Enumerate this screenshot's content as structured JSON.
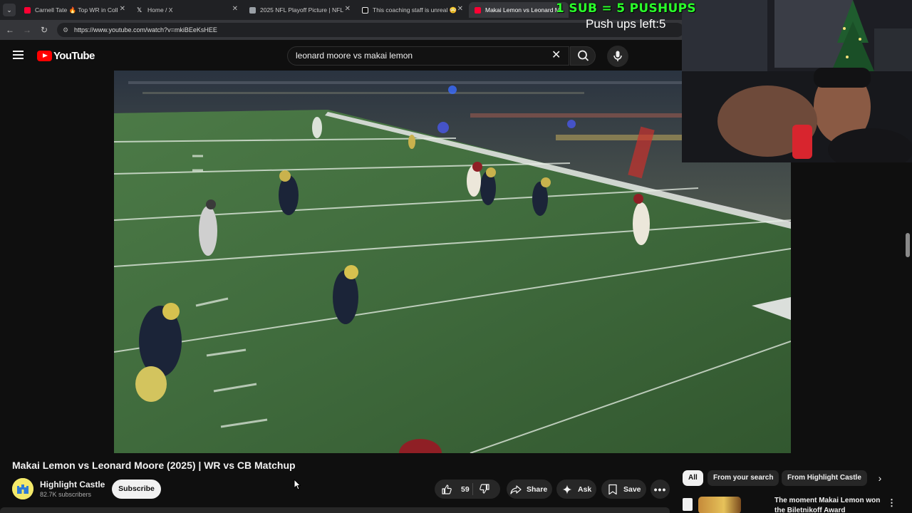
{
  "browser": {
    "tabs": [
      {
        "title": "Carnell Tate 🔥 Top WR in Coll",
        "fav_color": "#ff0033"
      },
      {
        "title": "Home / X",
        "fav_color": "#ffffff"
      },
      {
        "title": "2025 NFL Playoff Picture | NFL",
        "fav_color": "#9aa0a6"
      },
      {
        "title": "This coaching staff is unreal 😳",
        "fav_color": "#ffffff"
      },
      {
        "title": "Makai Lemon vs Leonard M",
        "fav_color": "#ff0033"
      }
    ],
    "url": "https://www.youtube.com/watch?v=mkiBEeKsHEE"
  },
  "youtube": {
    "logo_text": "YouTube",
    "search_query": "leonard moore vs makai lemon"
  },
  "overlay": {
    "sub_pushups": "1 SUB = 5 PUSHUPS",
    "pushups_left": "Push ups left:5"
  },
  "video": {
    "title": "Makai Lemon vs Leonard Moore (2025) | WR vs CB Matchup",
    "channel": "Highlight Castle",
    "subscribers": "82.7K subscribers",
    "subscribe_label": "Subscribe",
    "likes": "59",
    "share_label": "Share",
    "ask_label": "Ask",
    "save_label": "Save"
  },
  "sidebar": {
    "chips": [
      "All",
      "From your search",
      "From Highlight Castle"
    ],
    "recommendation_title": "The moment Makai Lemon won the Biletnikoff Award"
  },
  "colors": {
    "background": "#0f0f0f",
    "brand_red": "#ff0000",
    "overlay_green": "#2bff2b"
  }
}
